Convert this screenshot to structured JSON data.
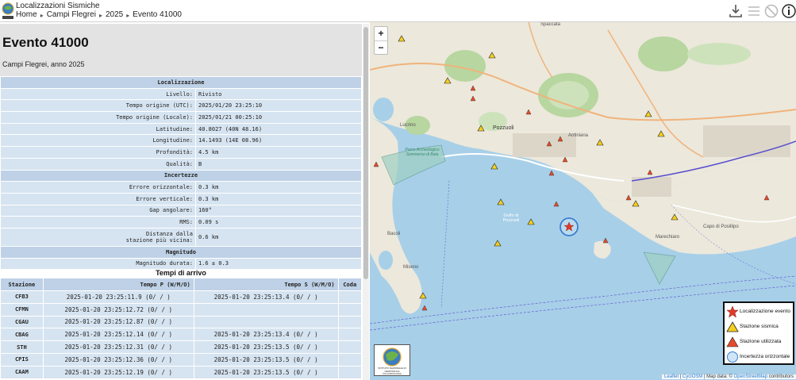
{
  "header": {
    "app_title": "Localizzazioni Sismiche",
    "breadcrumb": [
      "Home",
      "Campi Flegrei",
      "2025",
      "Evento 41000"
    ]
  },
  "event": {
    "title": "Evento 41000",
    "subtitle": "Campi Flegrei, anno 2025"
  },
  "info_sections": [
    {
      "title": "Localizzazione",
      "rows": [
        {
          "label": "Livello:",
          "value": "Rivisto"
        },
        {
          "label": "Tempo origine (UTC):",
          "value": "2025/01/20 23:25:10"
        },
        {
          "label": "Tempo origine (Locale):",
          "value": "2025/01/21 00:25:10"
        },
        {
          "label": "Latitudine:",
          "value": "40.8027 (40N 48.16)"
        },
        {
          "label": "Longitudine:",
          "value": "14.1493 (14E 08.96)"
        },
        {
          "label": "Profondità:",
          "value": "4.5 km"
        },
        {
          "label": "Qualità:",
          "value": "B"
        }
      ]
    },
    {
      "title": "Incertezze",
      "rows": [
        {
          "label": "Errore orizzontale:",
          "value": "0.3 km"
        },
        {
          "label": "Errore verticale:",
          "value": "0.3 km"
        },
        {
          "label": "Gap angolare:",
          "value": "160°"
        },
        {
          "label": "RMS:",
          "value": "0.09 s"
        },
        {
          "label": "Distanza dalla stazione più vicina:",
          "value": "0.6 km"
        }
      ]
    },
    {
      "title": "Magnitudo",
      "rows": [
        {
          "label": "Magnitudo durata:",
          "value": "1.6 ± 0.3"
        }
      ]
    }
  ],
  "arrivals": {
    "title": "Tempi di arrivo",
    "headers": [
      "Stazione",
      "Tempo P (W/M/O)",
      "Tempo S (W/M/O)",
      "Coda"
    ],
    "rows": [
      {
        "station": "CFB3",
        "p": "2025-01-20 23:25:11.9 (0/ / )",
        "s": "2025-01-20 23:25:13.4 (0/ / )",
        "coda": ""
      },
      {
        "station": "CFMN",
        "p": "2025-01-20 23:25:12.72 (0/ / )",
        "s": "",
        "coda": ""
      },
      {
        "station": "CGAU",
        "p": "2025-01-20 23:25:12.87 (0/ / )",
        "s": "",
        "coda": ""
      },
      {
        "station": "CBAG",
        "p": "2025-01-20 23:25:12.14 (0/ / )",
        "s": "2025-01-20 23:25:13.4 (0/ / )",
        "coda": ""
      },
      {
        "station": "STH",
        "p": "2025-01-20 23:25:12.31 (0/ / )",
        "s": "2025-01-20 23:25:13.5 (0/ / )",
        "coda": ""
      },
      {
        "station": "CPIS",
        "p": "2025-01-20 23:25:12.36 (0/ / )",
        "s": "2025-01-20 23:25:13.5 (0/ / )",
        "coda": ""
      },
      {
        "station": "CAAM",
        "p": "2025-01-20 23:25:12.19 (0/ / )",
        "s": "2025-01-20 23:25:13.5 (0/ / )",
        "coda": ""
      }
    ]
  },
  "map": {
    "zoom_in": "+",
    "zoom_out": "−",
    "labels": {
      "spaccata": "Spaccata",
      "lucrino": "Lucrino",
      "pozzuoli": "Pozzuoli",
      "parco": "Parco Archeologico Sommerso di Baia",
      "golfo": "Golfo di Pozzuoli",
      "bacoli": "Bacoli",
      "miseno": "Miseno",
      "marechiaro": "Marechiaro",
      "capo": "Capo di Posillipo",
      "antiniana": "Antiniana"
    },
    "legend": [
      {
        "label": "Localizzazione evento",
        "icon": "star-icon"
      },
      {
        "label": "Stazione sismica",
        "icon": "yellow-triangle-icon"
      },
      {
        "label": "Stazione utilizzata",
        "icon": "red-triangle-icon"
      },
      {
        "label": "Incertezza orizzontale",
        "icon": "circle-icon"
      }
    ],
    "attribution": {
      "leaflet": "Leaflet",
      "cyclosm": "CyclOSM",
      "mid": "| Map data: ©",
      "osm": "OpenStreetMap",
      "end": "contributors"
    },
    "logo_text": "ISTITUTO NAZIONALE DI GEOFISICA E VULCANOLOGIA"
  },
  "colors": {
    "sea": "#a7cfe8",
    "land": "#ece8dc",
    "section_blue": "#bed1e6",
    "row_blue": "#d6e4f1",
    "star_red": "#e03a2a",
    "station_yellow": "#f4d01e",
    "station_red": "#e34b2a"
  }
}
